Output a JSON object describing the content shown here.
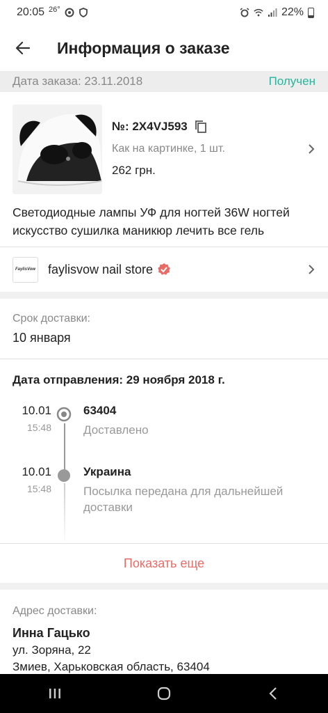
{
  "status_bar": {
    "time": "20:05",
    "temp": "26°",
    "battery": "22%",
    "icons": [
      "alarm-icon",
      "wifi-icon",
      "signal-icon",
      "battery-icon"
    ]
  },
  "header": {
    "title": "Информация о заказе",
    "back_icon": "arrow-left-icon"
  },
  "order": {
    "date_text": "Дата заказа: 23.11.2018",
    "status": "Получен",
    "status_color": "#2ab39a"
  },
  "product": {
    "number": "№: 2X4VJ593",
    "variant": "Как на картинке, 1 шт.",
    "price": "262 грн.",
    "name": "Светодиодные лампы УФ для ногтей 36W ногтей искусство сушилка маникюр лечить все гель"
  },
  "store": {
    "logo_text": "FaylisVow",
    "name": "faylisvow nail store"
  },
  "delivery": {
    "label": "Срок доставки:",
    "value": "10 января"
  },
  "shipping": {
    "title": "Дата отправления: 29 ноября 2018 г.",
    "events": [
      {
        "date": "10.01",
        "time": "15:48",
        "title": "63404",
        "desc": "Доставлено"
      },
      {
        "date": "10.01",
        "time": "15:48",
        "title": "Украина",
        "desc": "Посылка передана для дальнейшей доставки"
      }
    ],
    "more_label": "Показать еще",
    "more_color": "#e86c66"
  },
  "address": {
    "label": "Адрес доставки:",
    "name": "Инна Гацько",
    "line1": "ул. Зоряна, 22",
    "line2": "Змиев, Харьковская область, 63404"
  }
}
